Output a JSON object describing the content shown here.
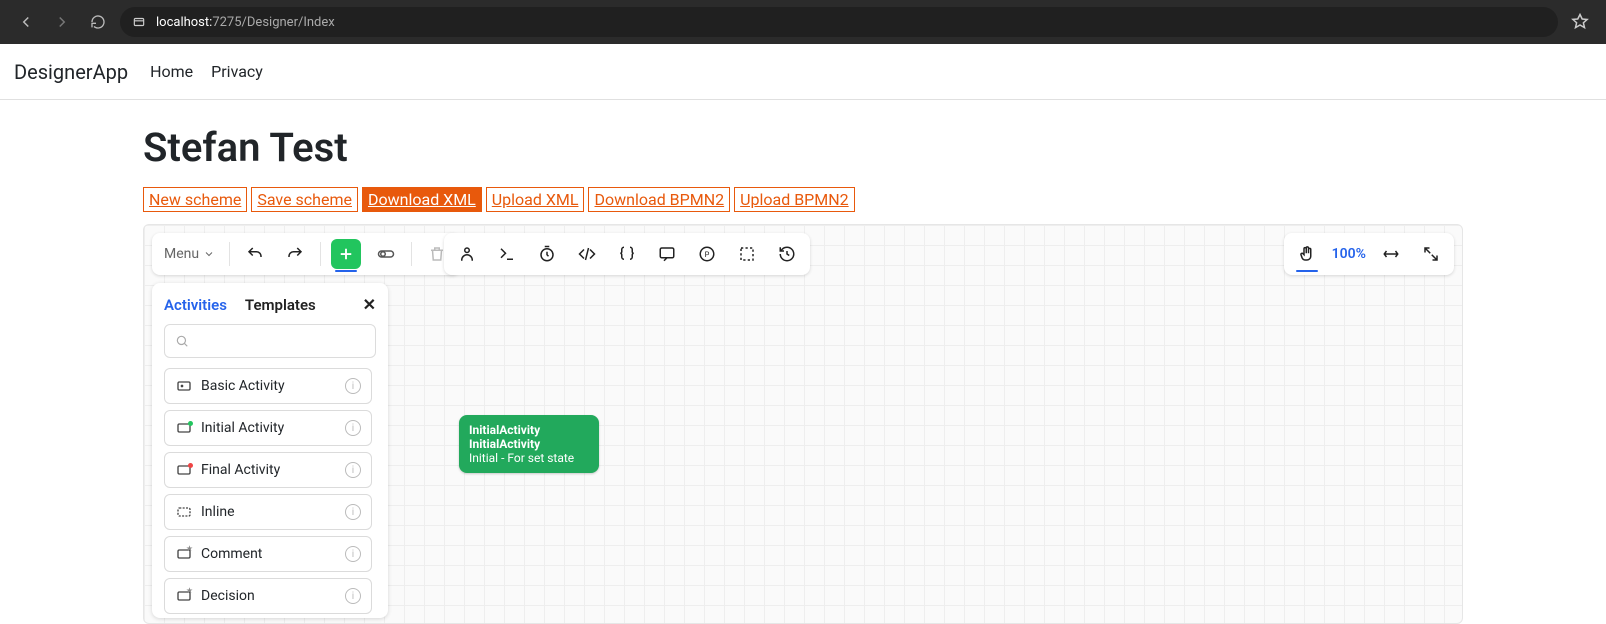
{
  "browser": {
    "url_host": "localhost:",
    "url_port_path": "7275/Designer/Index"
  },
  "nav": {
    "brand": "DesignerApp",
    "links": [
      "Home",
      "Privacy"
    ]
  },
  "page": {
    "title": "Stefan Test",
    "actions": [
      {
        "label": "New scheme",
        "active": false
      },
      {
        "label": "Save scheme",
        "active": false
      },
      {
        "label": "Download XML",
        "active": true
      },
      {
        "label": "Upload XML",
        "active": false
      },
      {
        "label": "Download BPMN2",
        "active": false
      },
      {
        "label": "Upload BPMN2",
        "active": false
      }
    ]
  },
  "toolbar": {
    "menu_label": "Menu",
    "zoom_pct": "100%"
  },
  "panel": {
    "tab_activities": "Activities",
    "tab_templates": "Templates",
    "activities": [
      {
        "label": "Basic Activity",
        "icon": "basic"
      },
      {
        "label": "Initial Activity",
        "icon": "initial"
      },
      {
        "label": "Final Activity",
        "icon": "final"
      },
      {
        "label": "Inline",
        "icon": "inline"
      },
      {
        "label": "Comment",
        "icon": "comment"
      },
      {
        "label": "Decision",
        "icon": "decision"
      }
    ]
  },
  "node": {
    "title": "InitialActivity",
    "subtitle": "InitialActivity",
    "desc": "Initial - For set state"
  }
}
